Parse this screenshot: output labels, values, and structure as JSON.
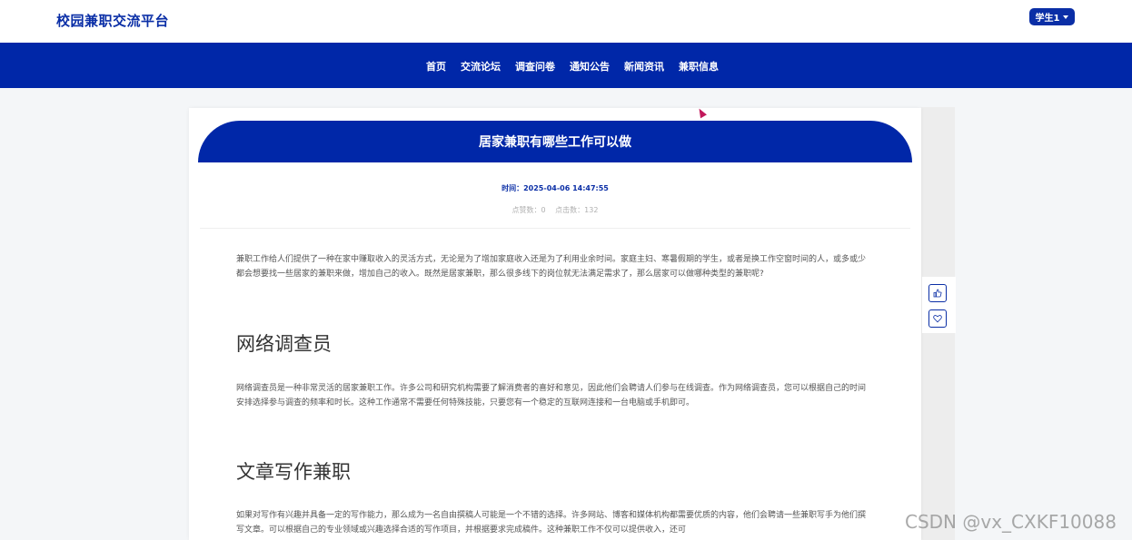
{
  "header": {
    "site_title": "校园兼职交流平台",
    "user_menu": "学生1"
  },
  "nav": {
    "items": [
      "首页",
      "交流论坛",
      "调查问卷",
      "通知公告",
      "新闻资讯",
      "兼职信息"
    ]
  },
  "article": {
    "title": "居家兼职有哪些工作可以做",
    "time_label": "时间：2025-04-06 14:47:55",
    "likes": "点赞数：0",
    "clicks": "点击数：132",
    "intro": "兼职工作给人们提供了一种在家中赚取收入的灵活方式，无论是为了增加家庭收入还是为了利用业余时间。家庭主妇、寒暑假期的学生，或者是换工作空窗时间的人，或多或少都会想要找一些居家的兼职来做，增加自己的收入。既然是居家兼职，那么很多线下的岗位就无法满足需求了，那么居家可以做哪种类型的兼职呢?",
    "section1_heading": "网络调查员",
    "section1_text": "网络调查员是一种非常灵活的居家兼职工作。许多公司和研究机构需要了解消费者的喜好和意见，因此他们会聘请人们参与在线调查。作为网络调查员，您可以根据自己的时间安排选择参与调查的频率和时长。这种工作通常不需要任何特殊技能，只要您有一个稳定的互联网连接和一台电脑或手机即可。",
    "section2_heading": "文章写作兼职",
    "section2_text": "如果对写作有兴趣并具备一定的写作能力，那么成为一名自由撰稿人可能是一个不错的选择。许多网站、博客和媒体机构都需要优质的内容，他们会聘请一些兼职写手为他们撰写文章。可以根据自己的专业领域或兴趣选择合适的写作项目，并根据要求完成稿件。这种兼职工作不仅可以提供收入，还可"
  },
  "side_actions": {
    "like_icon": "thumbs-up-icon",
    "favorite_icon": "heart-icon"
  },
  "watermark": "CSDN @vx_CXKF10088",
  "colors": {
    "primary": "#0027a8",
    "background": "#f4f6f8"
  }
}
